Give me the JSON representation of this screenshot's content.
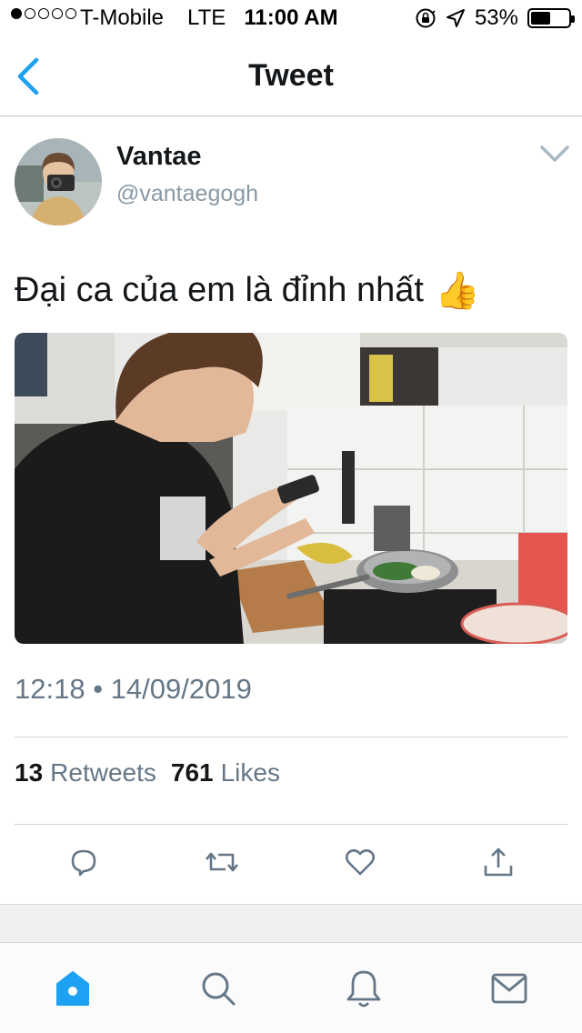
{
  "status_bar": {
    "carrier": "T-Mobile",
    "network": "LTE",
    "time": "11:00 AM",
    "battery_percent": "53%",
    "battery_level": 0.53,
    "signal_bars": 1,
    "signal_total": 5
  },
  "nav": {
    "title": "Tweet",
    "back_icon": "chevron-left-icon"
  },
  "tweet": {
    "author_name": "Vantae",
    "author_handle": "@vantaegogh",
    "text": "Đại ca của em là đỉnh nhất",
    "emoji": "👍",
    "timestamp": "12:18 • 14/09/2019",
    "retweets_count": "13",
    "retweets_label": "Retweets",
    "likes_count": "761",
    "likes_label": "Likes"
  },
  "actions": [
    "reply-icon",
    "retweet-icon",
    "like-icon",
    "share-icon"
  ],
  "tab_bar": [
    "home-icon",
    "search-icon",
    "notifications-icon",
    "messages-icon"
  ],
  "colors": {
    "accent": "#1da1f2",
    "text_primary": "#14171a",
    "text_secondary": "#657786",
    "icon_gray": "#657786"
  }
}
